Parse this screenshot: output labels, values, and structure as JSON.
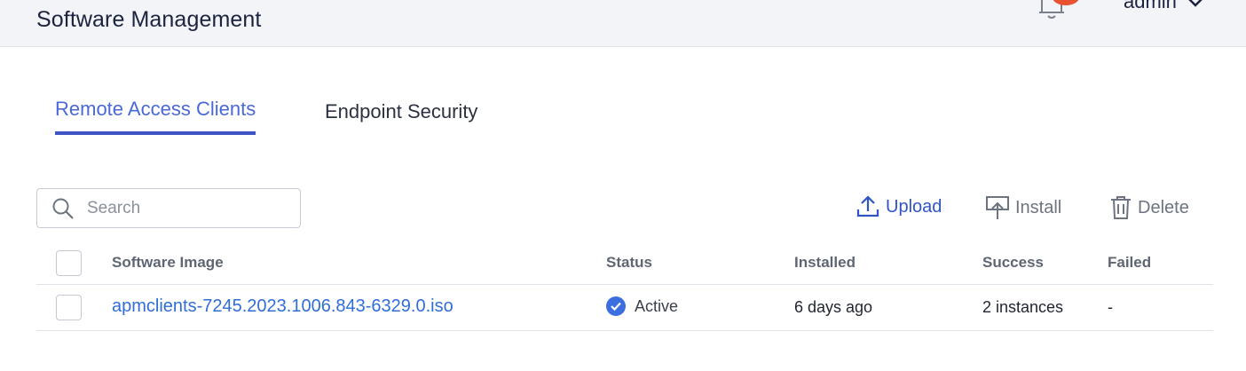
{
  "header": {
    "title": "Software Management",
    "user": "admin",
    "accent_color": "#3d55c4",
    "notification_color": "#e8522f"
  },
  "tabs": [
    {
      "label": "Remote Access Clients",
      "active": true
    },
    {
      "label": "Endpoint Security",
      "active": false
    }
  ],
  "search": {
    "placeholder": "Search",
    "value": ""
  },
  "actions": {
    "upload": "Upload",
    "install": "Install",
    "delete": "Delete"
  },
  "table": {
    "columns": [
      "Software Image",
      "Status",
      "Installed",
      "Success",
      "Failed"
    ],
    "rows": [
      {
        "software_image": "apmclients-7245.2023.1006.843-6329.0.iso",
        "status": "Active",
        "status_icon": "check-circle-icon",
        "installed": "6 days ago",
        "success": "2 instances",
        "failed": "-"
      }
    ]
  }
}
